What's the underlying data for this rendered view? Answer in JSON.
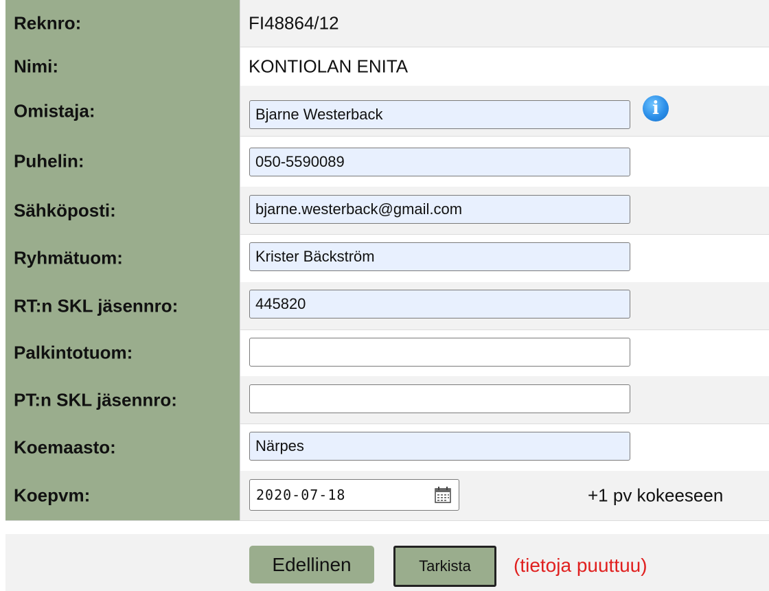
{
  "form": {
    "rows": [
      {
        "label": "Reknro:",
        "value": "FI48864/12"
      },
      {
        "label": "Nimi:",
        "value": "KONTIOLAN ENITA"
      },
      {
        "label": "Omistaja:",
        "value": "Bjarne Westerback"
      },
      {
        "label": "Puhelin:",
        "value": "050-5590089"
      },
      {
        "label": "Sähköposti:",
        "value": "bjarne.westerback@gmail.com"
      },
      {
        "label": "Ryhmätuom:",
        "value": "Krister Bäckström"
      },
      {
        "label": "RT:n SKL jäsennro:",
        "value": "445820"
      },
      {
        "label": "Palkintotuom:",
        "value": ""
      },
      {
        "label": "PT:n SKL jäsennro:",
        "value": ""
      },
      {
        "label": "Koemaasto:",
        "value": "Närpes"
      },
      {
        "label": "Koepvm:",
        "value": "2020-07-18"
      }
    ],
    "owner_info_icon": "info-icon",
    "date_picker_icon": "calendar-icon",
    "days_to_trial": "+1 pv kokeeseen"
  },
  "footer": {
    "prev_label": "Edellinen",
    "check_label": "Tarkista",
    "status_text": "(tietoja puuttuu)"
  },
  "colors": {
    "label_bg": "#9aad8d",
    "filled_field_bg": "#e8f0fe",
    "status_red": "#e0201f"
  }
}
